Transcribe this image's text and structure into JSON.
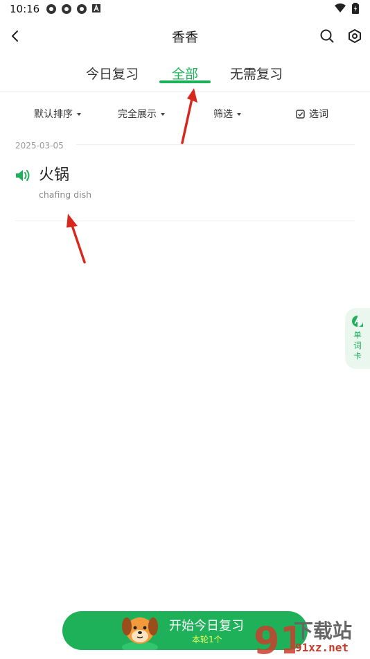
{
  "status_bar": {
    "time": "10:16"
  },
  "app_bar": {
    "title": "香香"
  },
  "tabs": [
    {
      "label": "今日复习",
      "active": false
    },
    {
      "label": "全部",
      "active": true
    },
    {
      "label": "无需复习",
      "active": false
    }
  ],
  "filters": {
    "sort": "默认排序",
    "display": "完全展示",
    "filter": "筛选",
    "select": "选词"
  },
  "list": {
    "date": "2025-03-05",
    "items": [
      {
        "word": "火锅",
        "meaning": "chafing dish"
      }
    ]
  },
  "side_card": {
    "line1": "单",
    "line2": "词",
    "line3": "卡"
  },
  "start_button": {
    "title": "开始今日复习",
    "subtitle": "本轮1个"
  },
  "watermark": {
    "top": "下载站",
    "bottom": "91xz.net",
    "mark": "91"
  },
  "colors": {
    "accent": "#1fb15a",
    "subtitle": "#e8ff5a",
    "arrow": "#d8271d"
  }
}
